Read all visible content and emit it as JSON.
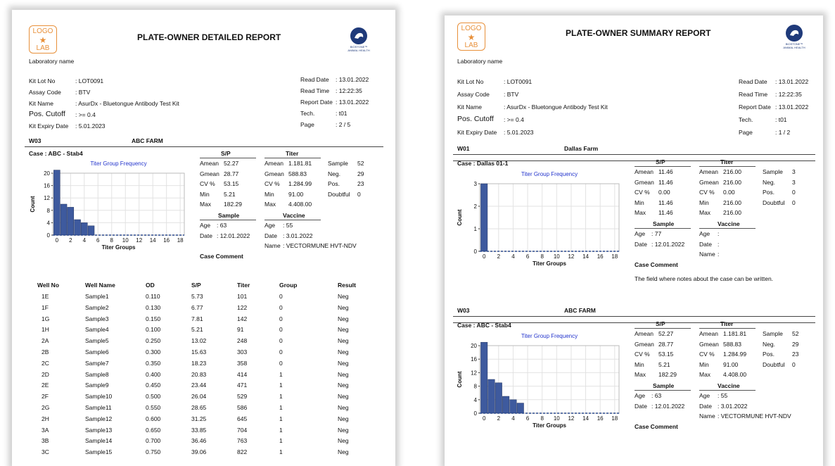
{
  "logo": {
    "line1": "LOGO",
    "star": "★",
    "line2": "LAB"
  },
  "seal": {
    "line1": "BIOSTONE™",
    "line2": "ANIMAL HEALTH"
  },
  "left": {
    "title": "PLATE-OWNER DETAILED REPORT",
    "lab": "Laboratory name",
    "info_left": [
      [
        "Kit Lot No",
        ": LOT0091"
      ],
      [
        "Assay Code",
        ": BTV"
      ],
      [
        "Kit Name",
        ": AsurDx - Bluetongue Antibody Test Kit"
      ],
      [
        "Pos. Cutoff",
        ": >= 0.4"
      ],
      [
        "Kit Expiry Date",
        ": 5.01.2023"
      ]
    ],
    "info_right": [
      [
        "Read Date",
        ": 13.01.2022"
      ],
      [
        "Read Time",
        ": 12:22:35"
      ],
      [
        "Report Date",
        ": 13.01.2022"
      ],
      [
        "Tech.",
        ": t01"
      ],
      [
        "Page",
        ": 2 / 5"
      ]
    ],
    "section": {
      "well": "W03",
      "farm": "ABC FARM",
      "case": "Case : ABC - Stab4"
    },
    "table": {
      "headers": [
        "Well No",
        "Well Name",
        "OD",
        "S/P",
        "Titer",
        "Group",
        "Result"
      ],
      "rows": [
        [
          "1E",
          "Sample1",
          "0.110",
          "5.73",
          "101",
          "0",
          "Neg"
        ],
        [
          "1F",
          "Sample2",
          "0.130",
          "6.77",
          "122",
          "0",
          "Neg"
        ],
        [
          "1G",
          "Sample3",
          "0.150",
          "7.81",
          "142",
          "0",
          "Neg"
        ],
        [
          "1H",
          "Sample4",
          "0.100",
          "5.21",
          "91",
          "0",
          "Neg"
        ],
        [
          "2A",
          "Sample5",
          "0.250",
          "13.02",
          "248",
          "0",
          "Neg"
        ],
        [
          "2B",
          "Sample6",
          "0.300",
          "15.63",
          "303",
          "0",
          "Neg"
        ],
        [
          "2C",
          "Sample7",
          "0.350",
          "18.23",
          "358",
          "0",
          "Neg"
        ],
        [
          "2D",
          "Sample8",
          "0.400",
          "20.83",
          "414",
          "1",
          "Neg"
        ],
        [
          "2E",
          "Sample9",
          "0.450",
          "23.44",
          "471",
          "1",
          "Neg"
        ],
        [
          "2F",
          "Sample10",
          "0.500",
          "26.04",
          "529",
          "1",
          "Neg"
        ],
        [
          "2G",
          "Sample11",
          "0.550",
          "28.65",
          "586",
          "1",
          "Neg"
        ],
        [
          "2H",
          "Sample12",
          "0.600",
          "31.25",
          "645",
          "1",
          "Neg"
        ],
        [
          "3A",
          "Sample13",
          "0.650",
          "33.85",
          "704",
          "1",
          "Neg"
        ],
        [
          "3B",
          "Sample14",
          "0.700",
          "36.46",
          "763",
          "1",
          "Neg"
        ],
        [
          "3C",
          "Sample15",
          "0.750",
          "39.06",
          "822",
          "1",
          "Neg"
        ]
      ]
    }
  },
  "right": {
    "title": "PLATE-OWNER SUMMARY REPORT",
    "lab": "Laboratory name",
    "info_left": [
      [
        "Kit Lot No",
        ": LOT0091"
      ],
      [
        "Assay Code",
        ": BTV"
      ],
      [
        "Kit Name",
        ": AsurDx - Bluetongue Antibody Test Kit"
      ],
      [
        "Pos. Cutoff",
        ": >= 0.4"
      ],
      [
        "Kit Expiry Date",
        ": 5.01.2023"
      ]
    ],
    "info_right": [
      [
        "Read Date",
        ": 13.01.2022"
      ],
      [
        "Read Time",
        ": 12:22:35"
      ],
      [
        "Report Date",
        ": 13.01.2022"
      ],
      [
        "Tech.",
        ": t01"
      ],
      [
        "Page",
        ": 1 / 2"
      ]
    ],
    "sections": [
      {
        "well": "W01",
        "farm": "Dallas Farm",
        "case": "Case : Dallas 01-1",
        "sp": {
          "header": "S/P",
          "rows": [
            [
              "Amean",
              "11.46"
            ],
            [
              "Gmean",
              "11.46"
            ],
            [
              "CV %",
              "0.00"
            ],
            [
              "Min",
              "11.46"
            ],
            [
              "Max",
              "11.46"
            ]
          ]
        },
        "titer": {
          "header": "Titer",
          "rows": [
            [
              "Amean",
              "216.00"
            ],
            [
              "Gmean",
              "216.00"
            ],
            [
              "CV %",
              "0.00"
            ],
            [
              "Min",
              "216.00"
            ],
            [
              "Max",
              "216.00"
            ]
          ]
        },
        "counts": [
          [
            "Sample",
            "3"
          ],
          [
            "Neg.",
            "3"
          ],
          [
            "Pos.",
            "0"
          ],
          [
            "Doubtful",
            "0"
          ]
        ],
        "sample": {
          "header": "Sample",
          "rows": [
            [
              "Age",
              ": 77"
            ],
            [
              "Date",
              ": 12.01.2022"
            ]
          ]
        },
        "vaccine": {
          "header": "Vaccine",
          "rows": [
            [
              "Age",
              ":"
            ],
            [
              "Date",
              ":"
            ],
            [
              "Name",
              ":"
            ]
          ]
        },
        "comment_label": "Case Comment",
        "comment": "The field where notes about the case can be written."
      },
      {
        "well": "W03",
        "farm": "ABC FARM",
        "case": "Case : ABC - Stab4",
        "sp": {
          "header": "S/P",
          "rows": [
            [
              "Amean",
              "52.27"
            ],
            [
              "Gmean",
              "28.77"
            ],
            [
              "CV %",
              "53.15"
            ],
            [
              "Min",
              "5.21"
            ],
            [
              "Max",
              "182.29"
            ]
          ]
        },
        "titer": {
          "header": "Titer",
          "rows": [
            [
              "Amean",
              "1.181.81"
            ],
            [
              "Gmean",
              "588.83"
            ],
            [
              "CV %",
              "1.284.99"
            ],
            [
              "Min",
              "91.00"
            ],
            [
              "Max",
              "4.408.00"
            ]
          ]
        },
        "counts": [
          [
            "Sample",
            "52"
          ],
          [
            "Neg.",
            "29"
          ],
          [
            "Pos.",
            "23"
          ],
          [
            "Doubtful",
            "0"
          ]
        ],
        "sample": {
          "header": "Sample",
          "rows": [
            [
              "Age",
              ": 63"
            ],
            [
              "Date",
              ": 12.01.2022"
            ]
          ]
        },
        "vaccine": {
          "header": "Vaccine",
          "rows": [
            [
              "Age",
              ": 55"
            ],
            [
              "Date",
              ": 3.01.2022"
            ],
            [
              "Name",
              ": VECTORMUNE HVT-NDV"
            ]
          ]
        },
        "comment_label": "Case Comment",
        "comment": ""
      }
    ]
  },
  "left_stats": {
    "sp": {
      "header": "S/P",
      "rows": [
        [
          "Amean",
          "52.27"
        ],
        [
          "Gmean",
          "28.77"
        ],
        [
          "CV %",
          "53.15"
        ],
        [
          "Min",
          "5.21"
        ],
        [
          "Max",
          "182.29"
        ]
      ]
    },
    "titer": {
      "header": "Titer",
      "rows": [
        [
          "Amean",
          "1.181.81"
        ],
        [
          "Gmean",
          "588.83"
        ],
        [
          "CV %",
          "1.284.99"
        ],
        [
          "Min",
          "91.00"
        ],
        [
          "Max",
          "4.408.00"
        ]
      ]
    },
    "counts": [
      [
        "Sample",
        "52"
      ],
      [
        "Neg.",
        "29"
      ],
      [
        "Pos.",
        "23"
      ],
      [
        "Doubtful",
        "0"
      ]
    ],
    "sample": {
      "header": "Sample",
      "rows": [
        [
          "Age",
          ": 63"
        ],
        [
          "Date",
          ": 12.01.2022"
        ]
      ]
    },
    "vaccine": {
      "header": "Vaccine",
      "rows": [
        [
          "Age",
          ": 55"
        ],
        [
          "Date",
          ": 3.01.2022"
        ],
        [
          "Name",
          ": VECTORMUNE HVT-NDV"
        ]
      ]
    },
    "comment_label": "Case Comment"
  },
  "chart_data": [
    {
      "type": "bar",
      "title": "Titer Group Frequency",
      "xlabel": "Titer Groups",
      "ylabel": "Count",
      "x": [
        0,
        1,
        2,
        3,
        4,
        5
      ],
      "values": [
        21,
        10,
        9,
        5,
        4,
        3
      ],
      "xlim": [
        0,
        18
      ],
      "ylim": [
        0,
        20
      ],
      "xticks": [
        0,
        2,
        4,
        6,
        8,
        10,
        12,
        14,
        16,
        18
      ],
      "yticks": [
        0,
        4,
        8,
        12,
        16,
        20
      ],
      "grid": true,
      "color": "#3e5a9e"
    },
    {
      "type": "bar",
      "title": "Titer Group Frequency",
      "xlabel": "Titer Groups",
      "ylabel": "Count",
      "x": [
        0
      ],
      "values": [
        3
      ],
      "xlim": [
        0,
        18
      ],
      "ylim": [
        0,
        3
      ],
      "xticks": [
        0,
        2,
        4,
        6,
        8,
        10,
        12,
        14,
        16,
        18
      ],
      "yticks": [
        0,
        1,
        2,
        3
      ],
      "grid": true,
      "color": "#3e5a9e"
    },
    {
      "type": "bar",
      "title": "Titer Group Frequency",
      "xlabel": "Titer Groups",
      "ylabel": "Count",
      "x": [
        0,
        1,
        2,
        3,
        4,
        5
      ],
      "values": [
        21,
        10,
        9,
        5,
        4,
        3
      ],
      "xlim": [
        0,
        18
      ],
      "ylim": [
        0,
        20
      ],
      "xticks": [
        0,
        2,
        4,
        6,
        8,
        10,
        12,
        14,
        16,
        18
      ],
      "yticks": [
        0,
        4,
        8,
        12,
        16,
        20
      ],
      "grid": true,
      "color": "#3e5a9e"
    }
  ]
}
